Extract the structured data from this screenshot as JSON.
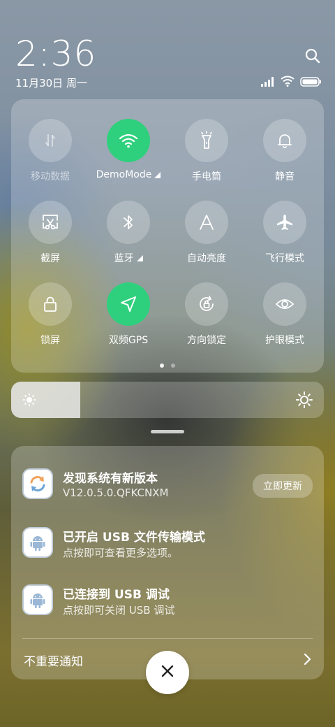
{
  "status": {
    "time": "2:36",
    "date": "11月30日 周一"
  },
  "quick_settings": {
    "tiles": [
      {
        "label": "移动数据",
        "icon": "mobile-data-icon",
        "active": false,
        "disabled": true,
        "has_arrow": false
      },
      {
        "label": "DemoMode",
        "icon": "wifi-icon",
        "active": true,
        "disabled": false,
        "has_arrow": true
      },
      {
        "label": "手电筒",
        "icon": "flashlight-icon",
        "active": false,
        "disabled": false,
        "has_arrow": false
      },
      {
        "label": "静音",
        "icon": "bell-icon",
        "active": false,
        "disabled": false,
        "has_arrow": false
      },
      {
        "label": "截屏",
        "icon": "screenshot-icon",
        "active": false,
        "disabled": false,
        "has_arrow": false
      },
      {
        "label": "蓝牙",
        "icon": "bluetooth-icon",
        "active": false,
        "disabled": false,
        "has_arrow": true
      },
      {
        "label": "自动亮度",
        "icon": "auto-brightness-icon",
        "active": false,
        "disabled": false,
        "has_arrow": false
      },
      {
        "label": "飞行模式",
        "icon": "airplane-icon",
        "active": false,
        "disabled": false,
        "has_arrow": false
      },
      {
        "label": "锁屏",
        "icon": "lock-icon",
        "active": false,
        "disabled": false,
        "has_arrow": false
      },
      {
        "label": "双频GPS",
        "icon": "gps-icon",
        "active": true,
        "disabled": false,
        "has_arrow": false
      },
      {
        "label": "方向锁定",
        "icon": "rotation-lock-icon",
        "active": false,
        "disabled": false,
        "has_arrow": false
      },
      {
        "label": "护眼模式",
        "icon": "eye-icon",
        "active": false,
        "disabled": false,
        "has_arrow": false
      }
    ],
    "page_count": 2,
    "current_page": 1
  },
  "brightness": {
    "level": 0.22
  },
  "notifications": {
    "items": [
      {
        "title": "发现系统有新版本",
        "body": "V12.0.5.0.QFKCNXM",
        "icon": "system-update-icon",
        "action": "立即更新"
      },
      {
        "title": "已开启 USB 文件传输模式",
        "body": "点按即可查看更多选项。",
        "icon": "android-icon"
      },
      {
        "title": "已连接到 USB 调试",
        "body": "点按即可关闭 USB 调试",
        "icon": "android-icon"
      }
    ],
    "footer_label": "不重要通知"
  },
  "colors": {
    "active_tile": "#2fd07d",
    "panel": "rgba(255,255,255,0.22)"
  }
}
